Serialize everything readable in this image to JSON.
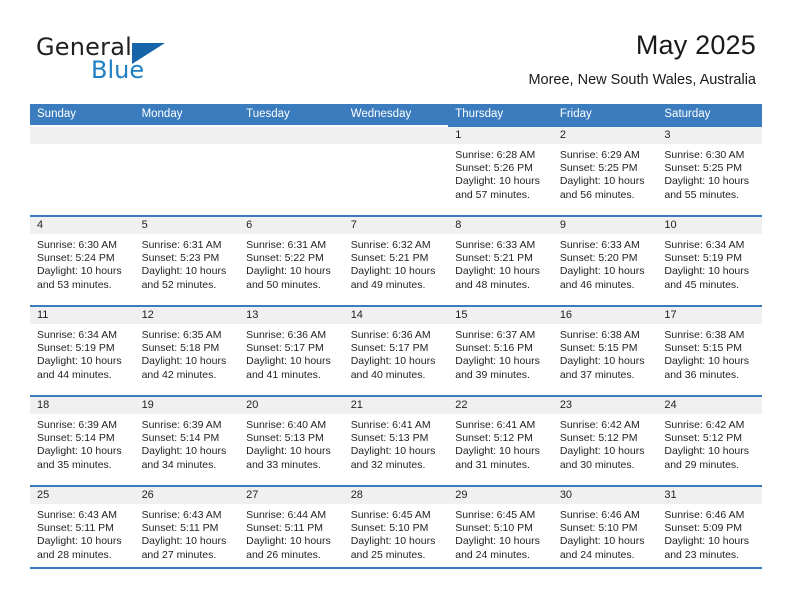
{
  "brand": {
    "word1": "General",
    "word2": "Blue",
    "flag_icon": "triangle-flag-icon",
    "accent_color": "#1f7fc4"
  },
  "header": {
    "title": "May 2025",
    "subtitle": "Moree, New South Wales, Australia"
  },
  "theme": {
    "header_blue": "#3a7cbe",
    "band_gray": "#f0f0f0",
    "text": "#231f20"
  },
  "calendar": {
    "weekday_headers": [
      "Sunday",
      "Monday",
      "Tuesday",
      "Wednesday",
      "Thursday",
      "Friday",
      "Saturday"
    ],
    "weeks": [
      [
        {
          "day": "",
          "sunrise": "",
          "sunset": "",
          "daylight": "",
          "empty": true
        },
        {
          "day": "",
          "sunrise": "",
          "sunset": "",
          "daylight": "",
          "empty": true
        },
        {
          "day": "",
          "sunrise": "",
          "sunset": "",
          "daylight": "",
          "empty": true
        },
        {
          "day": "",
          "sunrise": "",
          "sunset": "",
          "daylight": "",
          "empty": true
        },
        {
          "day": "1",
          "sunrise": "Sunrise: 6:28 AM",
          "sunset": "Sunset: 5:26 PM",
          "daylight": "Daylight: 10 hours and 57 minutes."
        },
        {
          "day": "2",
          "sunrise": "Sunrise: 6:29 AM",
          "sunset": "Sunset: 5:25 PM",
          "daylight": "Daylight: 10 hours and 56 minutes."
        },
        {
          "day": "3",
          "sunrise": "Sunrise: 6:30 AM",
          "sunset": "Sunset: 5:25 PM",
          "daylight": "Daylight: 10 hours and 55 minutes."
        }
      ],
      [
        {
          "day": "4",
          "sunrise": "Sunrise: 6:30 AM",
          "sunset": "Sunset: 5:24 PM",
          "daylight": "Daylight: 10 hours and 53 minutes."
        },
        {
          "day": "5",
          "sunrise": "Sunrise: 6:31 AM",
          "sunset": "Sunset: 5:23 PM",
          "daylight": "Daylight: 10 hours and 52 minutes."
        },
        {
          "day": "6",
          "sunrise": "Sunrise: 6:31 AM",
          "sunset": "Sunset: 5:22 PM",
          "daylight": "Daylight: 10 hours and 50 minutes."
        },
        {
          "day": "7",
          "sunrise": "Sunrise: 6:32 AM",
          "sunset": "Sunset: 5:21 PM",
          "daylight": "Daylight: 10 hours and 49 minutes."
        },
        {
          "day": "8",
          "sunrise": "Sunrise: 6:33 AM",
          "sunset": "Sunset: 5:21 PM",
          "daylight": "Daylight: 10 hours and 48 minutes."
        },
        {
          "day": "9",
          "sunrise": "Sunrise: 6:33 AM",
          "sunset": "Sunset: 5:20 PM",
          "daylight": "Daylight: 10 hours and 46 minutes."
        },
        {
          "day": "10",
          "sunrise": "Sunrise: 6:34 AM",
          "sunset": "Sunset: 5:19 PM",
          "daylight": "Daylight: 10 hours and 45 minutes."
        }
      ],
      [
        {
          "day": "11",
          "sunrise": "Sunrise: 6:34 AM",
          "sunset": "Sunset: 5:19 PM",
          "daylight": "Daylight: 10 hours and 44 minutes."
        },
        {
          "day": "12",
          "sunrise": "Sunrise: 6:35 AM",
          "sunset": "Sunset: 5:18 PM",
          "daylight": "Daylight: 10 hours and 42 minutes."
        },
        {
          "day": "13",
          "sunrise": "Sunrise: 6:36 AM",
          "sunset": "Sunset: 5:17 PM",
          "daylight": "Daylight: 10 hours and 41 minutes."
        },
        {
          "day": "14",
          "sunrise": "Sunrise: 6:36 AM",
          "sunset": "Sunset: 5:17 PM",
          "daylight": "Daylight: 10 hours and 40 minutes."
        },
        {
          "day": "15",
          "sunrise": "Sunrise: 6:37 AM",
          "sunset": "Sunset: 5:16 PM",
          "daylight": "Daylight: 10 hours and 39 minutes."
        },
        {
          "day": "16",
          "sunrise": "Sunrise: 6:38 AM",
          "sunset": "Sunset: 5:15 PM",
          "daylight": "Daylight: 10 hours and 37 minutes."
        },
        {
          "day": "17",
          "sunrise": "Sunrise: 6:38 AM",
          "sunset": "Sunset: 5:15 PM",
          "daylight": "Daylight: 10 hours and 36 minutes."
        }
      ],
      [
        {
          "day": "18",
          "sunrise": "Sunrise: 6:39 AM",
          "sunset": "Sunset: 5:14 PM",
          "daylight": "Daylight: 10 hours and 35 minutes."
        },
        {
          "day": "19",
          "sunrise": "Sunrise: 6:39 AM",
          "sunset": "Sunset: 5:14 PM",
          "daylight": "Daylight: 10 hours and 34 minutes."
        },
        {
          "day": "20",
          "sunrise": "Sunrise: 6:40 AM",
          "sunset": "Sunset: 5:13 PM",
          "daylight": "Daylight: 10 hours and 33 minutes."
        },
        {
          "day": "21",
          "sunrise": "Sunrise: 6:41 AM",
          "sunset": "Sunset: 5:13 PM",
          "daylight": "Daylight: 10 hours and 32 minutes."
        },
        {
          "day": "22",
          "sunrise": "Sunrise: 6:41 AM",
          "sunset": "Sunset: 5:12 PM",
          "daylight": "Daylight: 10 hours and 31 minutes."
        },
        {
          "day": "23",
          "sunrise": "Sunrise: 6:42 AM",
          "sunset": "Sunset: 5:12 PM",
          "daylight": "Daylight: 10 hours and 30 minutes."
        },
        {
          "day": "24",
          "sunrise": "Sunrise: 6:42 AM",
          "sunset": "Sunset: 5:12 PM",
          "daylight": "Daylight: 10 hours and 29 minutes."
        }
      ],
      [
        {
          "day": "25",
          "sunrise": "Sunrise: 6:43 AM",
          "sunset": "Sunset: 5:11 PM",
          "daylight": "Daylight: 10 hours and 28 minutes."
        },
        {
          "day": "26",
          "sunrise": "Sunrise: 6:43 AM",
          "sunset": "Sunset: 5:11 PM",
          "daylight": "Daylight: 10 hours and 27 minutes."
        },
        {
          "day": "27",
          "sunrise": "Sunrise: 6:44 AM",
          "sunset": "Sunset: 5:11 PM",
          "daylight": "Daylight: 10 hours and 26 minutes."
        },
        {
          "day": "28",
          "sunrise": "Sunrise: 6:45 AM",
          "sunset": "Sunset: 5:10 PM",
          "daylight": "Daylight: 10 hours and 25 minutes."
        },
        {
          "day": "29",
          "sunrise": "Sunrise: 6:45 AM",
          "sunset": "Sunset: 5:10 PM",
          "daylight": "Daylight: 10 hours and 24 minutes."
        },
        {
          "day": "30",
          "sunrise": "Sunrise: 6:46 AM",
          "sunset": "Sunset: 5:10 PM",
          "daylight": "Daylight: 10 hours and 24 minutes."
        },
        {
          "day": "31",
          "sunrise": "Sunrise: 6:46 AM",
          "sunset": "Sunset: 5:09 PM",
          "daylight": "Daylight: 10 hours and 23 minutes."
        }
      ]
    ]
  }
}
